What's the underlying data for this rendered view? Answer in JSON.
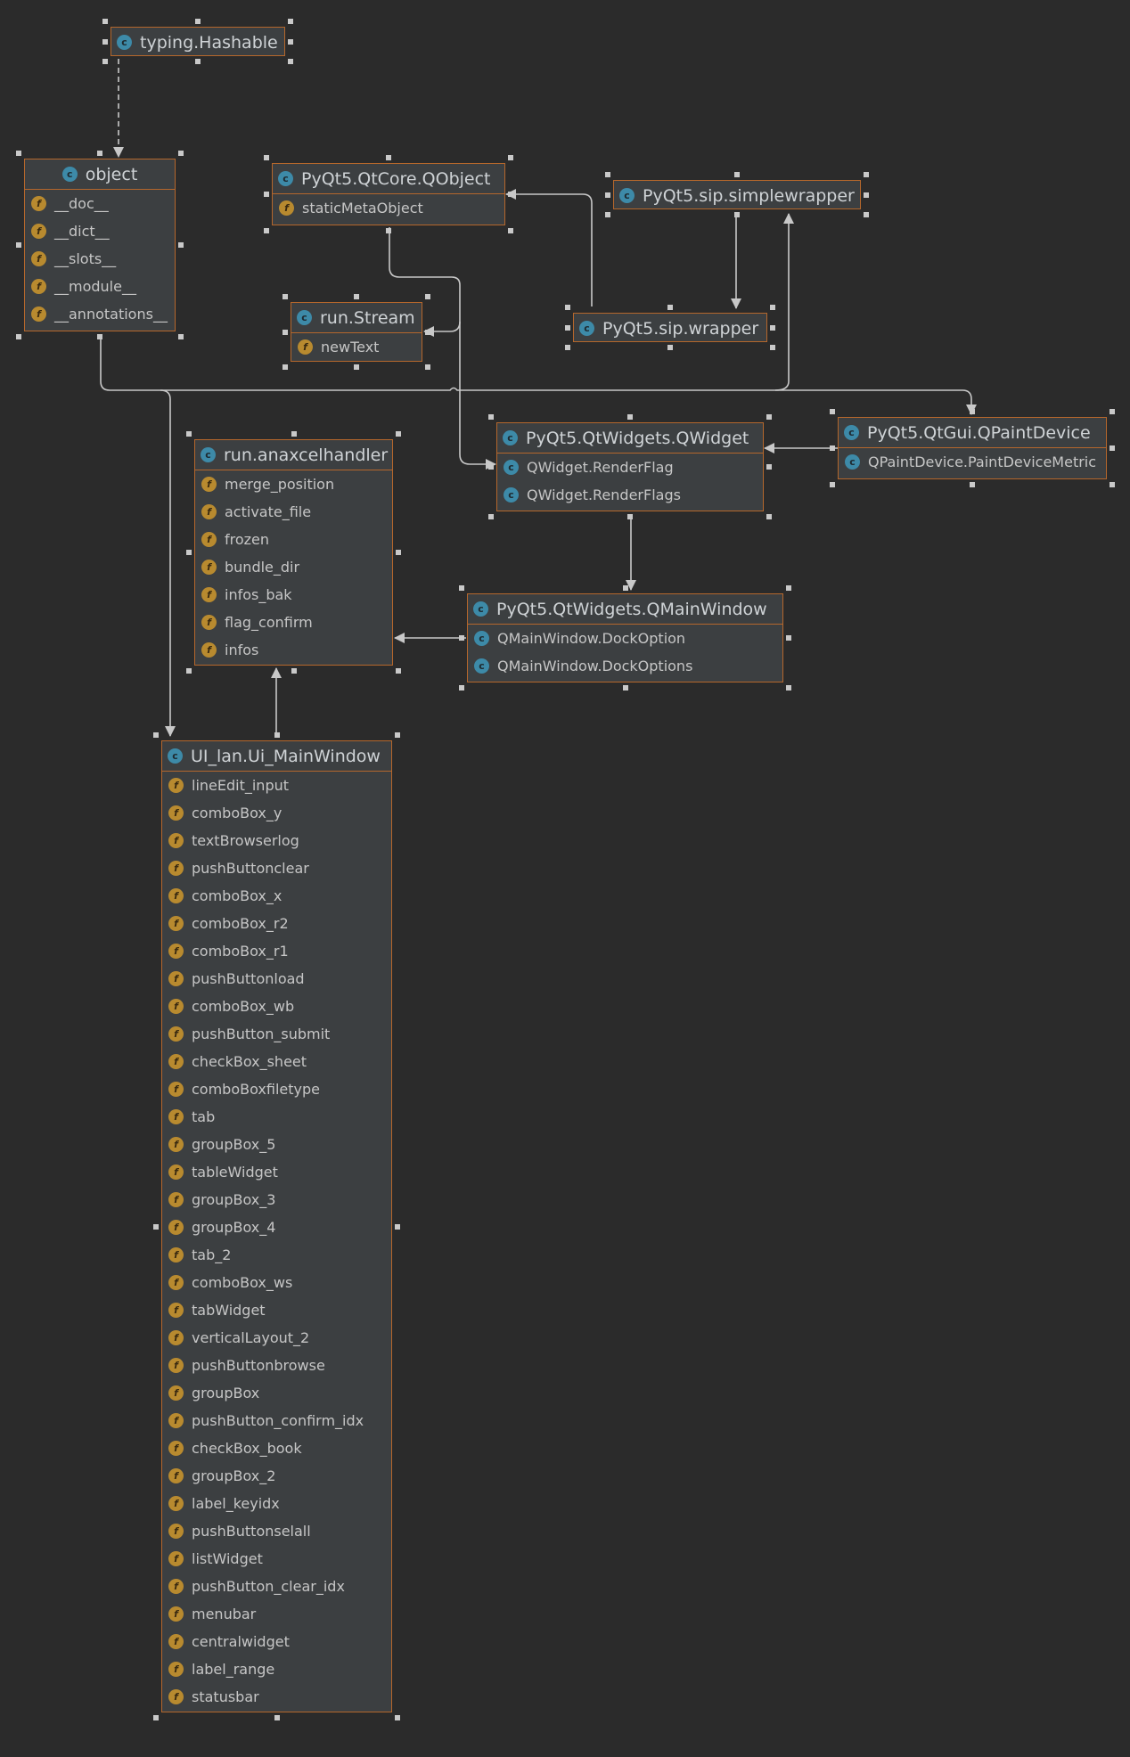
{
  "diagram": {
    "classes": {
      "hashable": {
        "name": "typing.Hashable",
        "members": []
      },
      "object": {
        "name": "object",
        "members": [
          "__doc__",
          "__dict__",
          "__slots__",
          "__module__",
          "__annotations__"
        ]
      },
      "qobject": {
        "name": "PyQt5.QtCore.QObject",
        "members": [
          "staticMetaObject"
        ]
      },
      "simplewrapper": {
        "name": "PyQt5.sip.simplewrapper",
        "members": []
      },
      "stream": {
        "name": "run.Stream",
        "members": [
          "newText"
        ]
      },
      "wrapper": {
        "name": "PyQt5.sip.wrapper",
        "members": []
      },
      "anaxcel": {
        "name": "run.anaxcelhandler",
        "members": [
          "merge_position",
          "activate_file",
          "frozen",
          "bundle_dir",
          "infos_bak",
          "flag_confirm",
          "infos"
        ]
      },
      "qwidget": {
        "name": "PyQt5.QtWidgets.QWidget",
        "nested": [
          "QWidget.RenderFlag",
          "QWidget.RenderFlags"
        ]
      },
      "qpaintdevice": {
        "name": "PyQt5.QtGui.QPaintDevice",
        "nested": [
          "QPaintDevice.PaintDeviceMetric"
        ]
      },
      "qmainwindow": {
        "name": "PyQt5.QtWidgets.QMainWindow",
        "nested": [
          "QMainWindow.DockOption",
          "QMainWindow.DockOptions"
        ]
      },
      "uimain": {
        "name": "UI_lan.Ui_MainWindow",
        "members": [
          "lineEdit_input",
          "comboBox_y",
          "textBrowserlog",
          "pushButtonclear",
          "comboBox_x",
          "comboBox_r2",
          "comboBox_r1",
          "pushButtonload",
          "comboBox_wb",
          "pushButton_submit",
          "checkBox_sheet",
          "comboBoxfiletype",
          "tab",
          "groupBox_5",
          "tableWidget",
          "groupBox_3",
          "groupBox_4",
          "tab_2",
          "comboBox_ws",
          "tabWidget",
          "verticalLayout_2",
          "pushButtonbrowse",
          "groupBox",
          "pushButton_confirm_idx",
          "checkBox_book",
          "groupBox_2",
          "label_keyidx",
          "pushButtonselall",
          "listWidget",
          "pushButton_clear_idx",
          "menubar",
          "centralwidget",
          "label_range",
          "statusbar"
        ]
      }
    },
    "edges": [
      {
        "from": "object",
        "to": "hashable",
        "style": "dashed"
      },
      {
        "from": "stream",
        "to": "qobject",
        "style": "solid"
      },
      {
        "from": "qobject",
        "to": "wrapper",
        "style": "solid"
      },
      {
        "from": "wrapper",
        "to": "simplewrapper",
        "style": "solid"
      },
      {
        "from": "qwidget",
        "to": "qobject",
        "style": "solid"
      },
      {
        "from": "qwidget",
        "to": "qpaintdevice",
        "style": "solid"
      },
      {
        "from": "qpaintdevice",
        "to": "simplewrapper",
        "style": "solid"
      },
      {
        "from": "qmainwindow",
        "to": "qwidget",
        "style": "solid"
      },
      {
        "from": "anaxcel",
        "to": "qmainwindow",
        "style": "solid"
      },
      {
        "from": "uimain",
        "to": "anaxcel",
        "style": "solid"
      },
      {
        "from": "uimain",
        "to": "object",
        "style": "solid"
      }
    ]
  },
  "colors": {
    "background": "#2b2b2b",
    "node_fill": "#3c3f41",
    "node_border": "#b5672c",
    "edge": "#c8c8c8",
    "class_badge": "#3d8aa8",
    "field_badge": "#b88a2f"
  },
  "icons": {
    "class": "class-icon",
    "field": "field-icon"
  },
  "badges": {
    "class_letter": "c",
    "field_letter": "f"
  }
}
